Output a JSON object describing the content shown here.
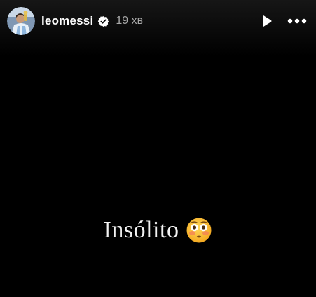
{
  "story": {
    "username": "leomessi",
    "time_ago": "19 хв",
    "caption": "Insólito",
    "emoji": "flushed-face"
  },
  "controls": {
    "play": "play-icon",
    "more": "more-icon"
  },
  "colors": {
    "background": "#000000",
    "text": "#ffffff",
    "muted": "#a8a8a8",
    "verified_badge": "#ffffff"
  }
}
